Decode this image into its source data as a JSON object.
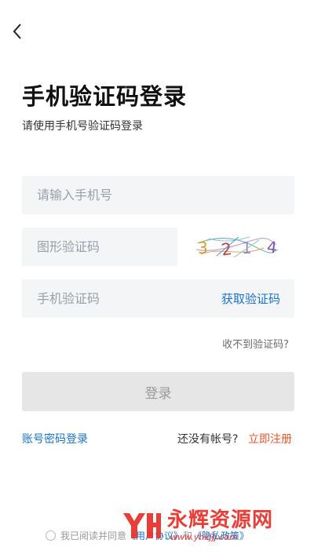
{
  "header": {
    "back_icon": "chevron-left-icon"
  },
  "title": "手机验证码登录",
  "subtitle": "请使用手机号验证码登录",
  "form": {
    "phone_placeholder": "请输入手机号",
    "captcha_placeholder": "图形验证码",
    "captcha_image_text": "3 2 1 4",
    "sms_placeholder": "手机验证码",
    "get_code_label": "获取验证码",
    "no_code_label": "收不到验证码?",
    "login_label": "登录"
  },
  "footer": {
    "password_login": "账号密码登录",
    "no_account": "还没有帐号?",
    "register": "立即注册"
  },
  "agreement": {
    "prefix": "我已阅读并同意",
    "user_agreement": "《用户协议》",
    "and": "和",
    "privacy_policy": "《隐私政策》"
  },
  "watermark": {
    "text": "永辉资源网",
    "url": "www.yhkjjj.com"
  },
  "colors": {
    "accent_blue": "#1a73c8",
    "register_orange": "#e8542b",
    "field_bg": "#f3f5f7",
    "button_disabled_bg": "#e6e6e6"
  }
}
